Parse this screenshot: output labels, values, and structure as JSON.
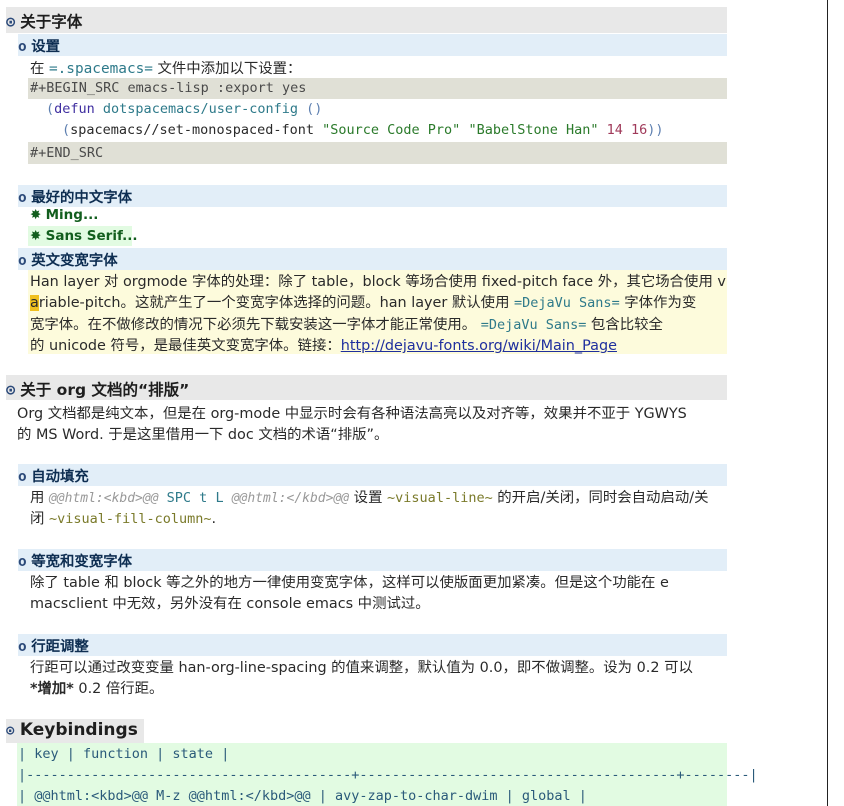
{
  "headings": {
    "fonts": "关于字体",
    "settings": "设置",
    "best_cn": "最好的中文字体",
    "en_font": "英文变宽字体",
    "typeset": "关于 org 文档的“排版”",
    "autofill": "自动填充",
    "monovar": "等宽和变宽字体",
    "spacing": "行距调整",
    "keybindings": "Keybindings"
  },
  "settings": {
    "intro_a": "在 ",
    "intro_file": "=.spacemacs=",
    "intro_b": " 文件中添加以下设置：",
    "begin_src": "#+BEGIN_SRC emacs-lisp :export yes",
    "c1_open": "(",
    "c1_defun": "defun",
    "c1_name": "dotspacemacs/user-config",
    "c1_args": "()",
    "c2_open": "(",
    "c2_call": "spacemacs//set-monospaced-font",
    "c2_s1": "\"Source Code Pro\"",
    "c2_s2": "\"BabelStone Han\"",
    "c2_n1": "14",
    "c2_n2": "16",
    "c2_close": "))",
    "end_src": "#+END_SRC"
  },
  "best_cn": {
    "star1": "✸",
    "item1": "Ming...",
    "star2": "✸",
    "item2": "Sans Serif..."
  },
  "en_font": {
    "l1": "Han layer 对 orgmode 字体的处理：除了 table，block 等场合使用 fixed-pitch face 外，其它场合使用 v",
    "l2_cursor": "a",
    "l2_a": "riable-pitch。这就产生了一个变宽字体选择的问题。han layer 默认使用 ",
    "l2_verb": "=DejaVu Sans=",
    "l2_b": " 字体作为变",
    "l3_a": "宽字体。在不做修改的情况下必须先下载安装这一字体才能正常使用。 ",
    "l3_verb": "=DejaVu Sans=",
    "l3_b": " 包含比较全",
    "l4_a": "的 unicode 符号，是最佳英文变宽字体。链接：",
    "l4_link": "http://dejavu-fonts.org/wiki/Main_Page"
  },
  "typeset": {
    "l1": "Org 文档都是纯文本，但是在 org-mode 中显示时会有各种语法高亮以及对齐等，效果并不亚于 YGWYS",
    "l2": "的 MS Word. 于是这里借用一下 doc 文档的术语“排版”。"
  },
  "autofill": {
    "a": "用 ",
    "html1": "@@html:<kbd>@@",
    "spc": " SPC t L ",
    "html2": "@@html:</kbd>@@",
    "b": " 设置 ",
    "c1": "~visual-line~",
    "c": " 的开启/关闭，同时会自动启动/关",
    "d": "闭 ",
    "c2": "~visual-fill-column~",
    "e": "."
  },
  "monovar": {
    "l1": "除了 table 和 block 等之外的地方一律使用变宽字体，这样可以使版面更加紧凑。但是这个功能在 e",
    "l2": "macsclient 中无效，另外没有在 console emacs 中测试过。"
  },
  "spacing": {
    "l1": "行距可以通过改变变量 han-org-line-spacing 的值来调整，默认值为 0.0，即不做调整。设为 0.2 可以",
    "l2_bold": "*增加*",
    "l2_rest": " 0.2 倍行距。"
  },
  "table": {
    "header": "| key                                    | function                              | state  |",
    "sep": "|----------------------------------------+---------------------------------------+--------|",
    "row1": "| @@html:<kbd>@@ M-z @@html:</kbd>@@     | avy-zap-to-char-dwim                  | global |"
  },
  "colors": {
    "h1_band": "#e8e8e8",
    "h2_band": "#e2eef8",
    "code_band": "#e0e0d6",
    "highlight_block": "#fdfbdc",
    "table_band": "#e2fbe2"
  }
}
